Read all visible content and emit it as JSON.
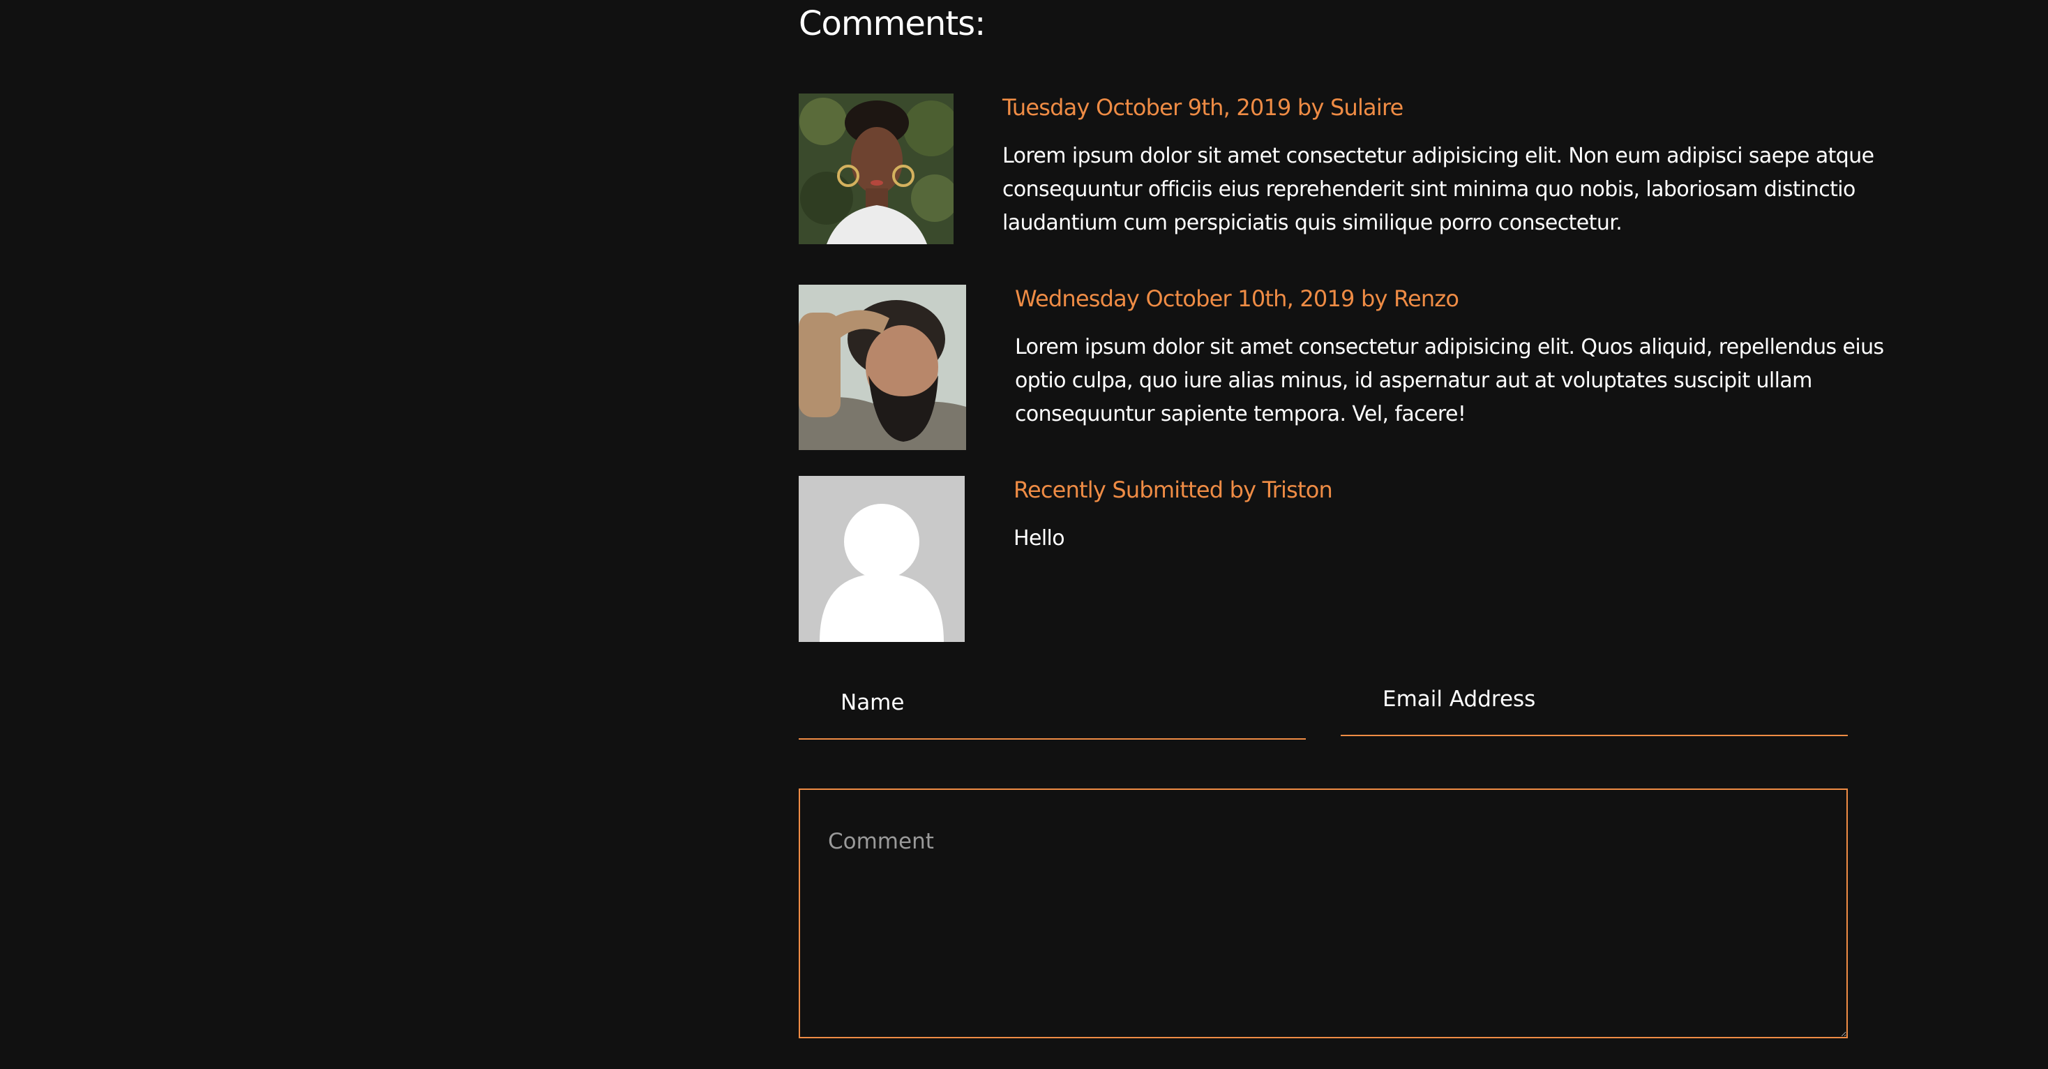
{
  "comments_section": {
    "title": "Comments:",
    "comments": [
      {
        "meta": "Tuesday October 9th, 2019 by Sulaire",
        "text": "Lorem ipsum dolor sit amet consectetur adipisicing elit. Non eum adipisci saepe atque consequuntur officiis eius reprehenderit sint minima quo nobis, laboriosam distinctio laudantium cum perspiciatis quis similique porro consectetur."
      },
      {
        "meta": "Wednesday October 10th, 2019 by Renzo",
        "text": "Lorem ipsum dolor sit amet consectetur adipisicing elit. Quos aliquid, repellendus eius optio culpa, quo iure alias minus, id aspernatur aut at voluptates suscipit ullam consequuntur sapiente tempora. Vel, facere!"
      },
      {
        "meta": "Recently Submitted by Triston",
        "text": "Hello"
      }
    ]
  },
  "form": {
    "name_placeholder": "Name",
    "email_placeholder": "Email Address",
    "comment_placeholder": "Comment"
  },
  "colors": {
    "background": "#111111",
    "accent": "#ef8c45",
    "text": "#ffffff"
  }
}
